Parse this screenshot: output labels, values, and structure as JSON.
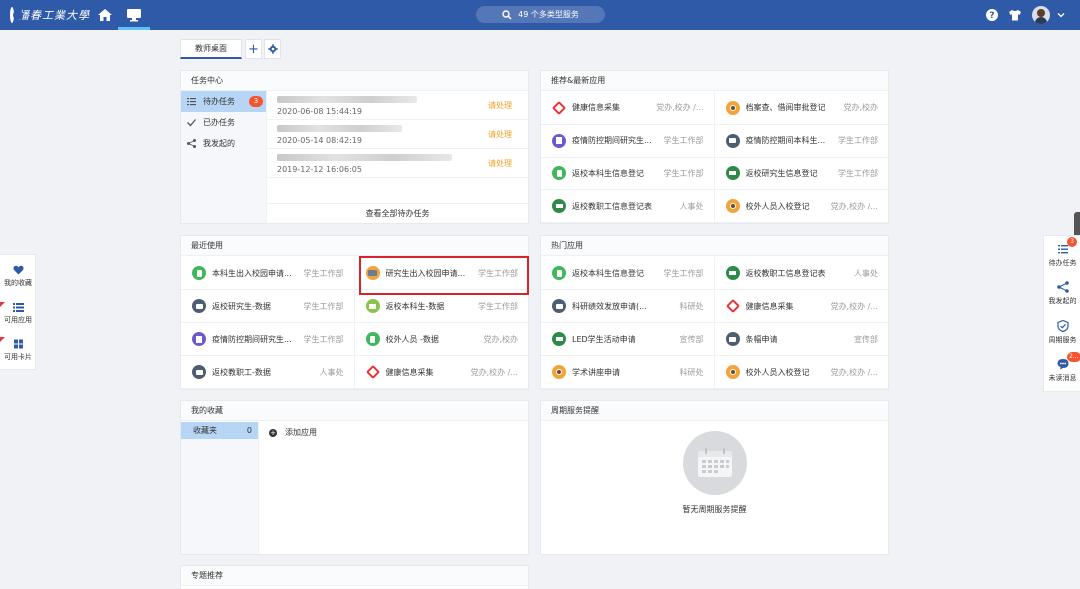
{
  "header": {
    "logo_text": "播春工業大學",
    "search_label": "49 个多类型服务"
  },
  "tabs": {
    "active_label": "教师桌面",
    "add_label": "+"
  },
  "task_center": {
    "title": "任务中心",
    "side": [
      {
        "label": "待办任务",
        "badge": "3"
      },
      {
        "label": "已办任务"
      },
      {
        "label": "我发起的"
      }
    ],
    "rows": [
      {
        "time": "2020-06-08 15:44:19",
        "status": "请处理"
      },
      {
        "time": "2020-05-14 08:42:19",
        "status": "请处理"
      },
      {
        "time": "2019-12-12 16:06:05",
        "status": "请处理"
      }
    ],
    "more_label": "查看全部待办任务"
  },
  "recommend": {
    "title": "推荐&最新应用",
    "apps": [
      {
        "name": "健康信息采集",
        "dept": "党办,校办 /..."
      },
      {
        "name": "档案查、借阅审批登记",
        "dept": "党办,校办"
      },
      {
        "name": "疫情防控期间研究生...",
        "dept": "学生工作部"
      },
      {
        "name": "疫情防控期间本科生...",
        "dept": "学生工作部"
      },
      {
        "name": "返校本科生信息登记",
        "dept": "学生工作部"
      },
      {
        "name": "返校研究生信息登记",
        "dept": "学生工作部"
      },
      {
        "name": "返校教职工信息登记表",
        "dept": "人事处"
      },
      {
        "name": "校外人员入校登记",
        "dept": "党办,校办 /..."
      }
    ]
  },
  "recent": {
    "title": "最近使用",
    "apps": [
      {
        "name": "本科生出入校园申请...",
        "dept": "学生工作部"
      },
      {
        "name": "研究生出入校园申请...",
        "dept": "学生工作部"
      },
      {
        "name": "返校研究生-数据",
        "dept": "学生工作部"
      },
      {
        "name": "返校本科生-数据",
        "dept": "学生工作部"
      },
      {
        "name": "疫情防控期间研究生...",
        "dept": "学生工作部"
      },
      {
        "name": "校外人员 -数据",
        "dept": "党办,校办"
      },
      {
        "name": "返校教职工-数据",
        "dept": "人事处"
      },
      {
        "name": "健康信息采集",
        "dept": "党办,校办 /..."
      }
    ]
  },
  "hot": {
    "title": "热门应用",
    "apps": [
      {
        "name": "返校本科生信息登记",
        "dept": "学生工作部"
      },
      {
        "name": "返校教职工信息登记表",
        "dept": "人事处"
      },
      {
        "name": "科研绩效发放申请(...",
        "dept": "科研处"
      },
      {
        "name": "健康信息采集",
        "dept": "党办,校办 /..."
      },
      {
        "name": "LED学生活动申请",
        "dept": "宣传部"
      },
      {
        "name": "条幅申请",
        "dept": "宣传部"
      },
      {
        "name": "学术讲座申请",
        "dept": "科研处"
      },
      {
        "name": "校外人员入校登记",
        "dept": "党办,校办 /..."
      }
    ]
  },
  "favorites": {
    "title": "我的收藏",
    "folder_label": "收藏夹",
    "folder_count": "0",
    "add_label": "添加应用"
  },
  "period": {
    "title": "周期服务提醒",
    "empty_text": "暂无周期服务提醒"
  },
  "topics": {
    "title": "专题推荐"
  },
  "left_float": {
    "items": [
      "我的收藏",
      "可用应用",
      "可用卡片"
    ]
  },
  "right_float": {
    "items": [
      {
        "label": "待办任务",
        "badge": "3"
      },
      {
        "label": "我发起的"
      },
      {
        "label": "周期服务"
      },
      {
        "label": "未读消息",
        "badge": "2..."
      }
    ]
  },
  "colors": {
    "topbar": "#2f5aa8",
    "badge": "#f4552f",
    "pending_status": "#f0a020",
    "highlight_box": "#d8232a"
  }
}
